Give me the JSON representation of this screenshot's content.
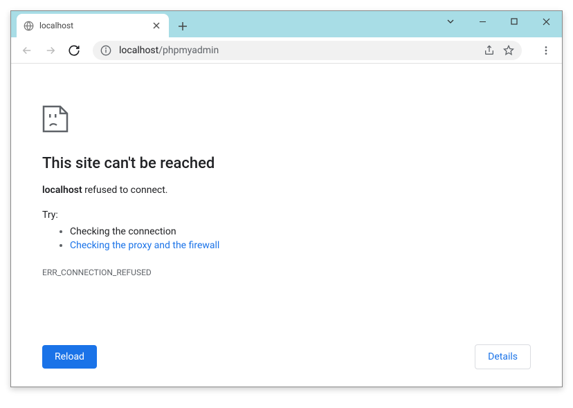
{
  "tab": {
    "title": "localhost"
  },
  "address": {
    "host": "localhost",
    "path": "/phpmyadmin"
  },
  "error": {
    "title": "This site can't be reached",
    "host": "localhost",
    "message_suffix": " refused to connect.",
    "try_label": "Try:",
    "suggestion_1": "Checking the connection",
    "suggestion_2": "Checking the proxy and the firewall",
    "code": "ERR_CONNECTION_REFUSED"
  },
  "buttons": {
    "reload": "Reload",
    "details": "Details"
  }
}
